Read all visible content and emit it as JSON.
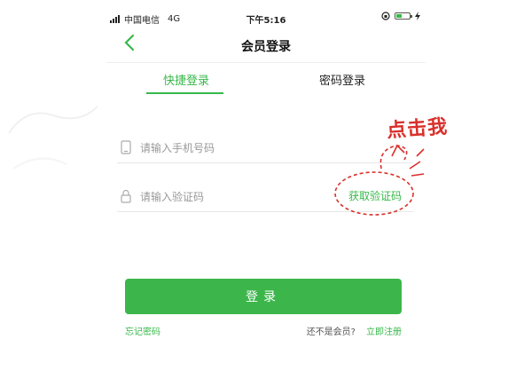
{
  "status_bar": {
    "carrier": "中国电信",
    "network": "4G",
    "time": "下午5:16",
    "battery_level": 0.45
  },
  "nav": {
    "title": "会员登录",
    "back_icon": "chevron-left-icon"
  },
  "tabs": [
    {
      "label": "快捷登录",
      "active": true
    },
    {
      "label": "密码登录",
      "active": false
    }
  ],
  "form": {
    "phone_placeholder": "请输入手机号码",
    "phone_icon": "phone-icon",
    "code_placeholder": "请输入验证码",
    "code_icon": "lock-icon",
    "get_code_label": "获取验证码"
  },
  "annotation": {
    "text": "点击我",
    "color": "#d9302b"
  },
  "login_button": "登录",
  "footer": {
    "forgot_password": "忘记密码",
    "not_member": "还不是会员?",
    "register": "立即注册"
  },
  "colors": {
    "accent": "#3cb64b",
    "text": "#222222",
    "placeholder": "#999999"
  }
}
